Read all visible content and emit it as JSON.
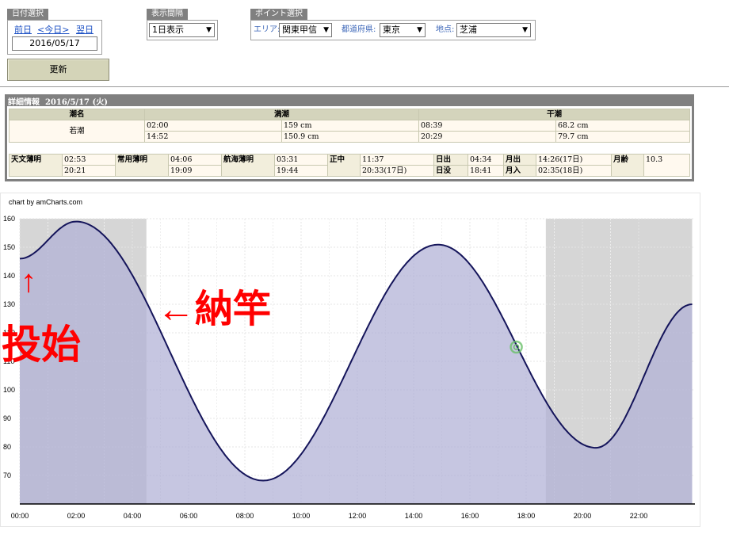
{
  "controls": {
    "date_group": {
      "label": "日付選択",
      "prev": "前日",
      "today": "<今日>",
      "next": "翌日",
      "date": "2016/05/17"
    },
    "interval_group": {
      "label": "表示間隔",
      "selected": "1日表示"
    },
    "point_group": {
      "label": "ポイント選択",
      "area_label": "エリア:",
      "area_value": "関東甲信",
      "pref_label": "都道府県:",
      "pref_value": "東京",
      "spot_label": "地点:",
      "spot_value": "芝浦"
    },
    "update_button": "更新"
  },
  "detail": {
    "title": "詳細情報",
    "date": "2016/5/17 (火)",
    "tide_table": {
      "headers": [
        "潮名",
        "満潮",
        "干潮"
      ],
      "tide_name": "若潮",
      "high": [
        {
          "time": "02:00",
          "level": "159 cm"
        },
        {
          "time": "14:52",
          "level": "150.9 cm"
        }
      ],
      "low": [
        {
          "time": "08:39",
          "level": "68.2 cm"
        },
        {
          "time": "20:29",
          "level": "79.7 cm"
        }
      ]
    },
    "sun_table": {
      "astro_twilight": {
        "label": "天文薄明",
        "am": "02:53",
        "pm": "20:21"
      },
      "civil_twilight": {
        "label": "常用薄明",
        "am": "04:06",
        "pm": "19:09"
      },
      "nautical_twilight": {
        "label": "航海薄明",
        "am": "03:31",
        "pm": "19:44"
      },
      "noon": {
        "label": "正中",
        "am": "11:37",
        "pm": "20:33(17日)"
      },
      "sunrise": {
        "label": "日出",
        "value": "04:34"
      },
      "sunset": {
        "label": "日没",
        "value": "18:41"
      },
      "moonrise": {
        "label": "月出",
        "value": "14:26(17日)"
      },
      "moonset": {
        "label": "月入",
        "value": "02:35(18日)"
      },
      "moon_age": {
        "label": "月齢",
        "value": "10.3"
      }
    }
  },
  "chart_data": {
    "type": "area",
    "credit": "chart by amCharts.com",
    "x_ticks": [
      "00:00",
      "02:00",
      "04:00",
      "06:00",
      "08:00",
      "10:00",
      "12:00",
      "14:00",
      "16:00",
      "18:00",
      "20:00",
      "22:00"
    ],
    "y_ticks": [
      70,
      80,
      90,
      100,
      110,
      120,
      130,
      140,
      150,
      160
    ],
    "xlim": [
      0,
      24
    ],
    "ylim": [
      60,
      160
    ],
    "x_unit": "hours",
    "tide_extrema": [
      {
        "t": 0.0,
        "v": 146
      },
      {
        "t": 2.0,
        "v": 159
      },
      {
        "t": 8.65,
        "v": 68.2
      },
      {
        "t": 14.87,
        "v": 150.9
      },
      {
        "t": 20.48,
        "v": 79.7
      },
      {
        "t": 23.9,
        "v": 130
      }
    ],
    "night_shading": [
      {
        "from": 0.0,
        "to": 4.5
      },
      {
        "from": 18.7,
        "to": 23.9
      }
    ],
    "current_marker": {
      "t": 17.65,
      "v": 115
    },
    "colors": {
      "line": "#14145a",
      "fill": "#b0b0d6",
      "night": "#d6d6d6",
      "marker": "#6abf6a"
    }
  },
  "annotations": {
    "start_text": "投始",
    "start_arrow": "↑",
    "end_text": "←納竿",
    "color": "#ff0000"
  }
}
